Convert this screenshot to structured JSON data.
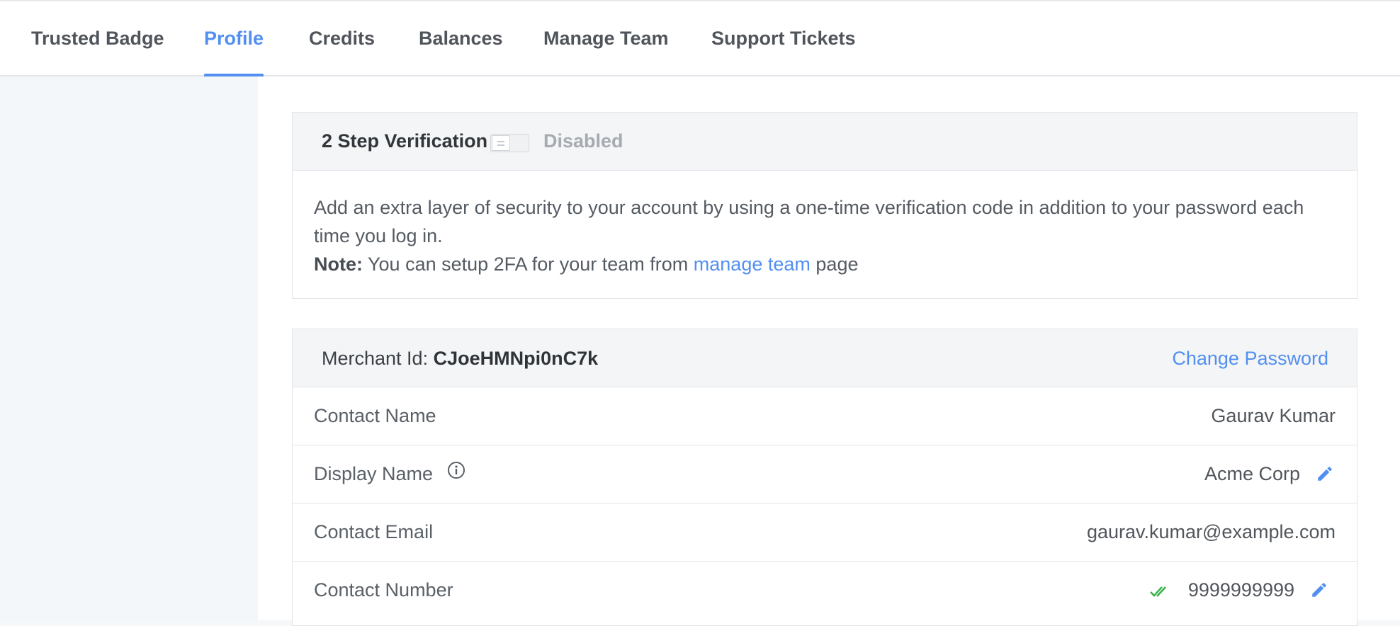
{
  "tabs": [
    {
      "label": "Trusted Badge"
    },
    {
      "label": "Profile",
      "active": true
    },
    {
      "label": "Credits"
    },
    {
      "label": "Balances"
    },
    {
      "label": "Manage Team"
    },
    {
      "label": "Support Tickets"
    }
  ],
  "two_factor": {
    "title": "2 Step Verification",
    "status": "Disabled",
    "toggle_on": false,
    "description": "Add an extra layer of security to your account by using a one-time verification code in addition to your password each time you log in.",
    "note_label": "Note:",
    "note_before": "You can setup 2FA for your team from",
    "note_link": "manage team",
    "note_after": "page"
  },
  "merchant": {
    "label": "Merchant Id:",
    "id": "CJoeHMNpi0nC7k",
    "change_password": "Change Password"
  },
  "profile_rows": {
    "contact_name": {
      "label": "Contact Name",
      "value": "Gaurav Kumar"
    },
    "display_name": {
      "label": "Display Name",
      "value": "Acme Corp"
    },
    "contact_email": {
      "label": "Contact Email",
      "value": "gaurav.kumar@example.com"
    },
    "contact_number": {
      "label": "Contact Number",
      "value": "9999999999"
    }
  },
  "colors": {
    "accent": "#528ff0",
    "verified": "#3fb24f",
    "header_bg": "#f4f5f6",
    "sidebar_bg": "#f4f7f9"
  },
  "icons": {
    "info": "info-circle-icon",
    "edit": "pencil-icon",
    "verified": "double-check-icon"
  }
}
